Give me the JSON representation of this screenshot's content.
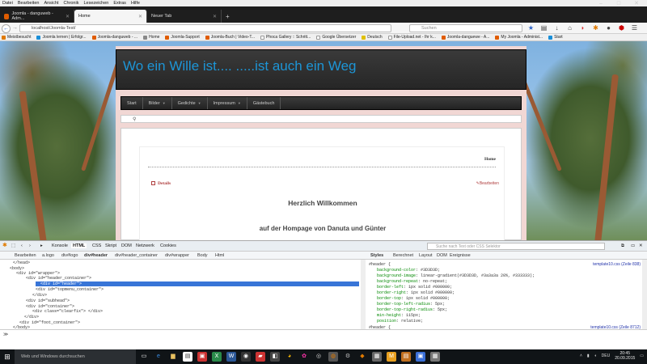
{
  "menubar": {
    "items": [
      "Datei",
      "Bearbeiten",
      "Ansicht",
      "Chronik",
      "Lesezeichen",
      "Extras",
      "Hilfe"
    ]
  },
  "tabs": [
    {
      "label": "Joomla - danguweb - Adm..."
    },
    {
      "label": "Home"
    },
    {
      "label": "Neuer Tab"
    }
  ],
  "nav": {
    "url": "localhost/Joomla-Test/",
    "search_placeholder": "Suchen"
  },
  "bookmarks": [
    "Meistbesucht",
    "Joomla lernen | Erfolgr...",
    "Joomla-danguweb - ...",
    "Home",
    "Joomla-Support",
    "Joomla-Buch | Video-T...",
    "Phoca Gallery :: Schritt...",
    "Google Übersetzer",
    "Deutsch",
    "File-Upload.net - Ihr k...",
    "Joomla-danguewe - A...",
    "My Joomla - Administ...",
    "Start"
  ],
  "site": {
    "title": "Wo ein Wille ist.... .....ist auch ein Weg",
    "menu": [
      {
        "label": "Start",
        "has_sub": false
      },
      {
        "label": "Bilder",
        "has_sub": true
      },
      {
        "label": "Gedichte",
        "has_sub": true
      },
      {
        "label": "Impressum",
        "has_sub": true
      },
      {
        "label": "Gästebuch",
        "has_sub": false
      }
    ],
    "breadcrumb_icon": "map-pin-icon",
    "home_link": "Home",
    "details": "Details",
    "edit": "Bearbeiten",
    "welcome": "Herzlich Willkommen",
    "subwelcome": "auf der Hompage von Danuta und Günter"
  },
  "devtools": {
    "toolbar": [
      "Konsole",
      "HTML",
      "CSS",
      "Skript",
      "DOM",
      "Netzwerk",
      "Cookies"
    ],
    "active_tab": "HTML",
    "search_placeholder": "Suche nach Text oder CSS Selektor",
    "crumbs": [
      "Bearbeiten",
      "a.logo",
      "div#logo",
      "div#header",
      "div#header_container",
      "div#wrapper",
      "Body",
      "Html"
    ],
    "html_lines": [
      "</head>",
      "<body>",
      "<div id=\"wrapper\">",
      "<div id=\"header_container\">",
      "<div id=\"header\">",
      "<div id=\"topmenu_container\">",
      "</div>",
      "<div id=\"subhead\">",
      "<div id=\"container\">",
      "<div class=\"clearfix\"> </div>",
      "</div>",
      "<div id=\"foot_container\">",
      "</body>"
    ],
    "styles_tabs": [
      "Styles",
      "Berechnet",
      "Layout",
      "DOM",
      "Ereignisse"
    ],
    "rule_selector": "#header {",
    "rule_source": "template10.css (Zeile 838)",
    "properties": [
      {
        "name": "background-color",
        "value": "#3D3D3D;"
      },
      {
        "name": "background-image",
        "value": "linear-gradient(#3D3D3D, #3a3a3a 20%, #333333);"
      },
      {
        "name": "background-repeat",
        "value": "no-repeat;"
      },
      {
        "name": "border-left",
        "value": "1px solid #000000;"
      },
      {
        "name": "border-right",
        "value": "1px solid #000000;"
      },
      {
        "name": "border-top",
        "value": "1px solid #000000;"
      },
      {
        "name": "border-top-left-radius",
        "value": "5px;"
      },
      {
        "name": "border-top-right-radius",
        "value": "5px;"
      },
      {
        "name": "min-height",
        "value": "115px;"
      },
      {
        "name": "position",
        "value": "relative;"
      }
    ],
    "rule2_selector": "#header {",
    "rule2_source": "template10.css (Zeile 8712)"
  },
  "taskbar": {
    "search": "Web und Windows durchsuchen",
    "lang": "DEU",
    "time": "20:45",
    "date": "20.09.2015"
  }
}
